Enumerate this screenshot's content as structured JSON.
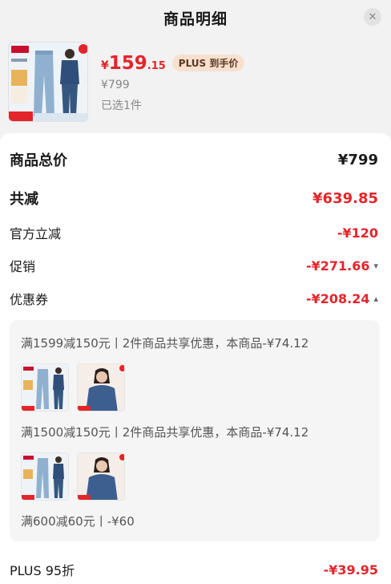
{
  "header": {
    "title": "商品明细",
    "close_icon": "close-icon"
  },
  "product": {
    "price_symbol": "¥",
    "price_int": "159",
    "price_dec": ".15",
    "plus_badge": "PLUS 到手价",
    "original_price": "¥799",
    "selected": "已选1件"
  },
  "summary": {
    "total_label": "商品总价",
    "total_value": "¥799",
    "reduce_label": "共减",
    "reduce_value": "¥639.85"
  },
  "discounts": [
    {
      "label": "官方立减",
      "value": "-¥120",
      "chevron": ""
    },
    {
      "label": "促销",
      "value": "-¥271.66",
      "chevron": "chevron-down-icon"
    },
    {
      "label": "优惠券",
      "value": "-¥208.24",
      "chevron": "chevron-up-icon"
    }
  ],
  "coupons": [
    {
      "text": "满1599减150元丨2件商品共享优惠，本商品-¥74.12"
    },
    {
      "text": "满1500减150元丨2件商品共享优惠，本商品-¥74.12"
    },
    {
      "text": "满600减60元丨-¥60"
    }
  ],
  "plus_row": {
    "label": "PLUS 95折",
    "value": "-¥39.95"
  },
  "colors": {
    "accent": "#e4252b",
    "badge_bg": "#f8e0cf",
    "card": "#ffffff",
    "bg": "#f2f2f2"
  }
}
